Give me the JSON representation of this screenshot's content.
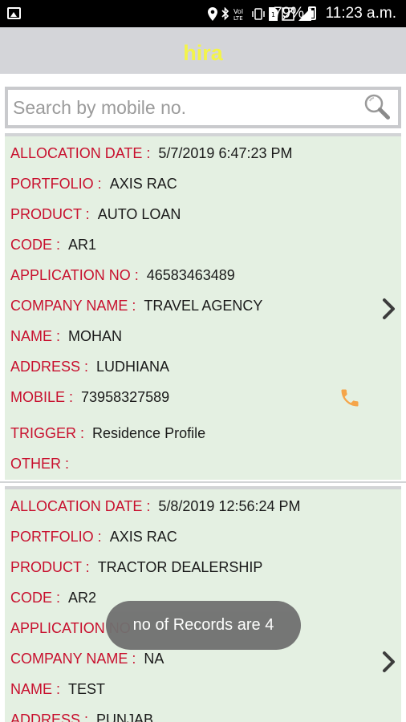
{
  "status_bar": {
    "battery": "79%",
    "time": "11:23 a.m.",
    "icons": [
      "gallery-icon",
      "location-icon",
      "bluetooth-icon",
      "volte-icon",
      "vibrate-icon",
      "sim-icon",
      "no-sim-icon",
      "signal-icon",
      "battery-icon"
    ]
  },
  "app_bar": {
    "title": "hira"
  },
  "search": {
    "placeholder": "Search by mobile no."
  },
  "records": [
    {
      "allocation_date_label": "ALLOCATION DATE :",
      "allocation_date": "5/7/2019 6:47:23 PM",
      "portfolio_label": "PORTFOLIO :",
      "portfolio": "AXIS RAC",
      "product_label": "PRODUCT :",
      "product": "AUTO LOAN",
      "code_label": "CODE :",
      "code": "AR1",
      "application_no_label": "APPLICATION NO :",
      "application_no": "46583463489",
      "company_name_label": "COMPANY NAME :",
      "company_name": "TRAVEL AGENCY",
      "name_label": "NAME :",
      "name": "MOHAN",
      "address_label": "ADDRESS :",
      "address": "LUDHIANA",
      "mobile_label": "MOBILE :",
      "mobile": "73958327589",
      "trigger_label": "TRIGGER :",
      "trigger": "Residence Profile",
      "other_label": "OTHER :",
      "other": ""
    },
    {
      "allocation_date_label": "ALLOCATION DATE :",
      "allocation_date": "5/8/2019 12:56:24 PM",
      "portfolio_label": "PORTFOLIO :",
      "portfolio": "AXIS RAC",
      "product_label": "PRODUCT :",
      "product": "TRACTOR DEALERSHIP",
      "code_label": "CODE :",
      "code": "AR2",
      "application_no_label": "APPLICATION NO",
      "company_name_label": "COMPANY NAME :",
      "company_name": "NA",
      "name_label": "NAME :",
      "name": "TEST",
      "address_label": "ADDRESS :",
      "address": "PUNJAB"
    }
  ],
  "toast": {
    "message": "no of Records are 4"
  },
  "colors": {
    "label": "#c8102e",
    "title": "#f3f44a",
    "card_bg": "#e4f0e2",
    "app_bar_bg": "#d4d5d9",
    "phone_icon": "#f5a54a"
  }
}
